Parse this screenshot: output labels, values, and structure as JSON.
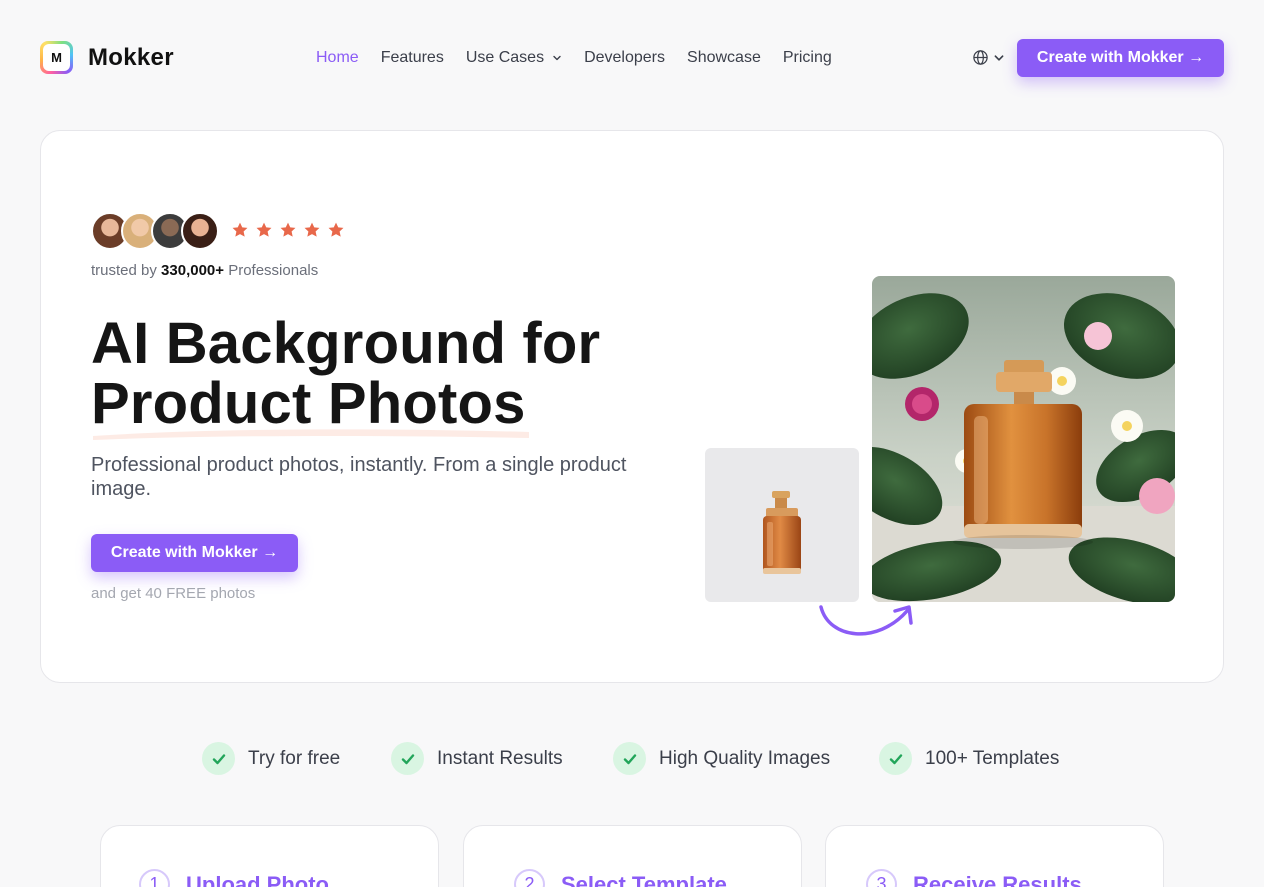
{
  "brand": {
    "logo_letter": "M",
    "name": "Mokker"
  },
  "nav": {
    "items": [
      {
        "label": "Home",
        "active": true,
        "dropdown": false
      },
      {
        "label": "Features",
        "active": false,
        "dropdown": false
      },
      {
        "label": "Use Cases",
        "active": false,
        "dropdown": true
      },
      {
        "label": "Developers",
        "active": false,
        "dropdown": false
      },
      {
        "label": "Showcase",
        "active": false,
        "dropdown": false
      },
      {
        "label": "Pricing",
        "active": false,
        "dropdown": false
      }
    ],
    "language_icon": "globe-icon",
    "cta_label": "Create with Mokker →"
  },
  "hero": {
    "rating_stars": 5,
    "trusted_prefix": "trusted by ",
    "trusted_count": "330,000+",
    "trusted_suffix": " Professionals",
    "title_line1": "AI Background for",
    "title_line2": "Product Photos",
    "subtitle": "Professional product photos, instantly. From a single product image.",
    "cta_label": "Create with Mokker →",
    "cta_note": "and get 40 FREE photos"
  },
  "features": [
    {
      "label": "Try for free"
    },
    {
      "label": "Instant Results"
    },
    {
      "label": "High Quality Images"
    },
    {
      "label": "100+ Templates"
    }
  ],
  "steps": [
    {
      "number": "1",
      "title": "Upload Photo"
    },
    {
      "number": "2",
      "title": "Select Template"
    },
    {
      "number": "3",
      "title": "Receive Results"
    }
  ],
  "colors": {
    "accent": "#8b5cf6",
    "star": "#e8684a",
    "check_bg": "#d9f5e2",
    "check": "#22a55a"
  }
}
